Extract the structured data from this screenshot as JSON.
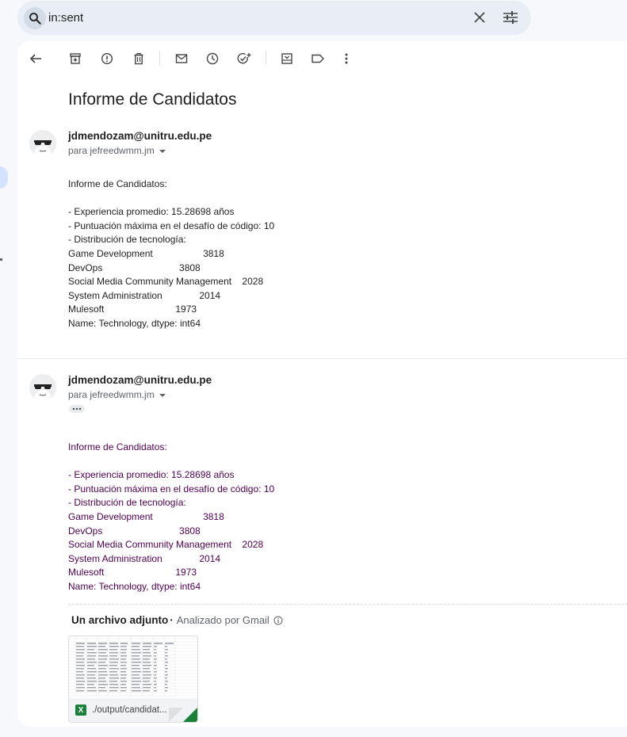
{
  "search": {
    "query": "in:sent"
  },
  "toolbar": {
    "icons": [
      "back-arrow-icon",
      "archive-icon",
      "report-spam-icon",
      "delete-icon",
      "mark-unread-icon",
      "snooze-icon",
      "add-task-icon",
      "move-to-icon",
      "label-icon",
      "more-vert-icon"
    ]
  },
  "subject": "Informe de Candidatos",
  "messages": [
    {
      "sender": "jdmendozam@unitru.edu.pe",
      "to": "para jefreedwmm.jm",
      "body": "Informe de Candidatos:\n\n- Experiencia promedio: 15.28698 años\n- Puntuación máxima en el desafío de código: 10\n- Distribución de tecnología:\nGame Development                   3818\nDevOps                             3808\nSocial Media Community Management    2028\nSystem Administration              2014\nMulesoft                           1973\nName: Technology, dtype: int64"
    },
    {
      "sender": "jdmendozam@unitru.edu.pe",
      "to": "para jefreedwmm.jm",
      "body": "Informe de Candidatos:\n\n- Experiencia promedio: 15.28698 años\n- Puntuación máxima en el desafío de código: 10\n- Distribución de tecnología:\nGame Development                   3818\nDevOps                             3808\nSocial Media Community Management    2028\nSystem Administration              2014\nMulesoft                           1973\nName: Technology, dtype: int64"
    }
  ],
  "attachments": {
    "title": "Un archivo adjunto",
    "scanned": "Analizado por Gmail",
    "filename": "./output/candidat..."
  },
  "colors": {
    "quoted_text": "#500050",
    "excel_green": "#188038"
  }
}
